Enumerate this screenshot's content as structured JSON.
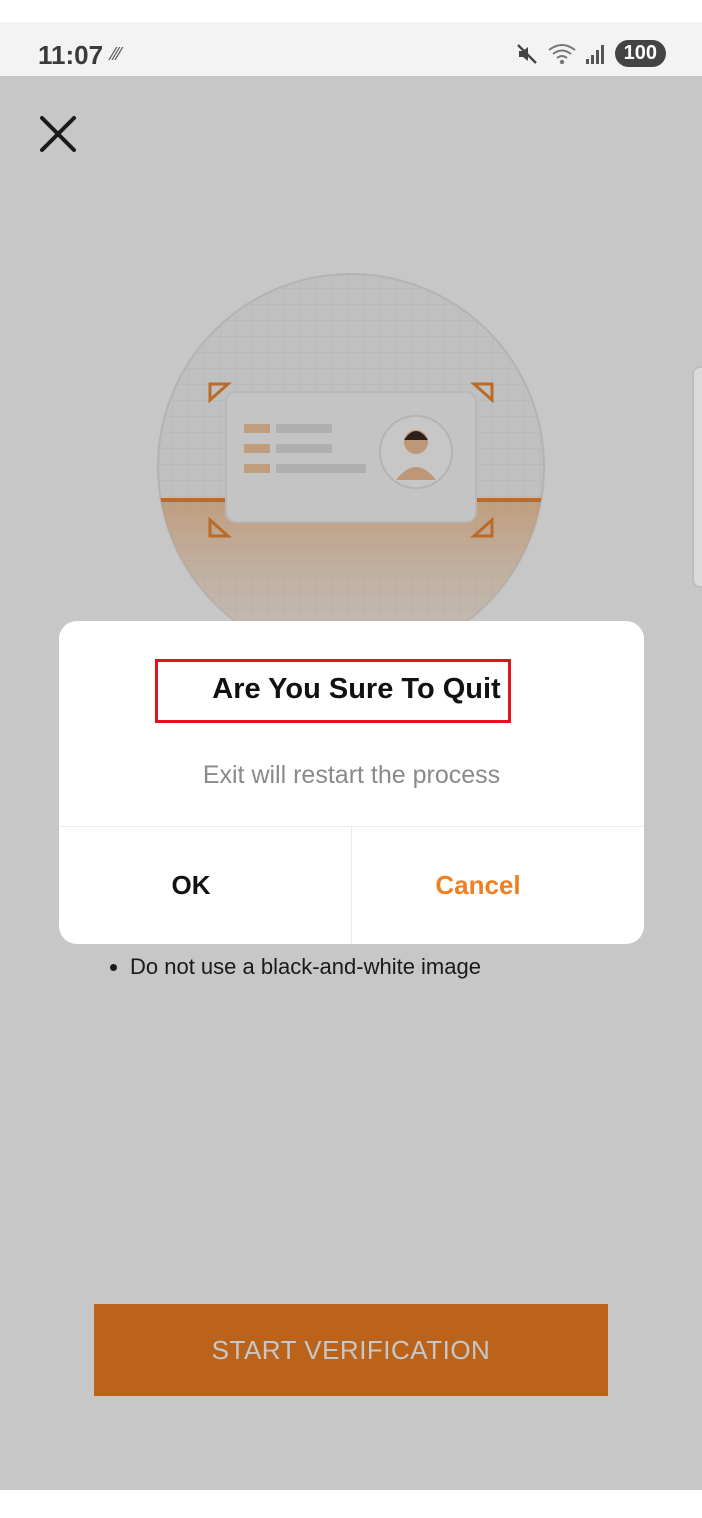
{
  "status_bar": {
    "time": "11:07",
    "extra_glyph": "⁄⁄⁄",
    "battery": "100",
    "icons": [
      "mute-icon",
      "wifi-icon",
      "signal-icon",
      "battery-icon"
    ]
  },
  "page": {
    "tips": [
      "Do not use a black-and-white image"
    ],
    "start_button_label": "START VERIFICATION"
  },
  "dialog": {
    "title": "Are You Sure To Quit",
    "message": "Exit will restart the process",
    "ok_label": "OK",
    "cancel_label": "Cancel"
  },
  "colors": {
    "accent": "#f07f22",
    "highlight_border": "#e0141e",
    "overlay": "rgba(0,0,0,0.22)"
  }
}
